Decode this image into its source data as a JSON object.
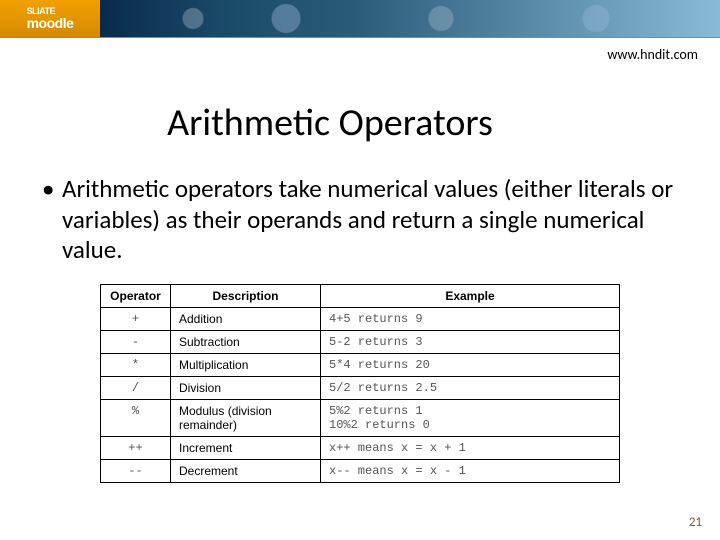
{
  "banner": {
    "brand_top": "SLIATE",
    "brand_bottom": "moodle"
  },
  "url": "www.hndit.com",
  "title": "Arithmetic Operators",
  "bullet_text": "Arithmetic operators take numerical values (either literals or variables) as their operands and return a single numerical value.",
  "table": {
    "headers": {
      "op": "Operator",
      "desc": "Description",
      "ex": "Example"
    },
    "rows": [
      {
        "op": "+",
        "desc": "Addition",
        "ex": "4+5 returns 9"
      },
      {
        "op": "-",
        "desc": "Subtraction",
        "ex": "5-2 returns 3"
      },
      {
        "op": "*",
        "desc": "Multiplication",
        "ex": "5*4 returns 20"
      },
      {
        "op": "/",
        "desc": "Division",
        "ex": "5/2 returns 2.5"
      },
      {
        "op": "%",
        "desc": "Modulus (division remainder)",
        "ex": "5%2 returns 1\n10%2 returns 0"
      },
      {
        "op": "++",
        "desc": "Increment",
        "ex": "x++ means x = x + 1"
      },
      {
        "op": "--",
        "desc": "Decrement",
        "ex": "x-- means x = x - 1"
      }
    ]
  },
  "slide_number": "21"
}
